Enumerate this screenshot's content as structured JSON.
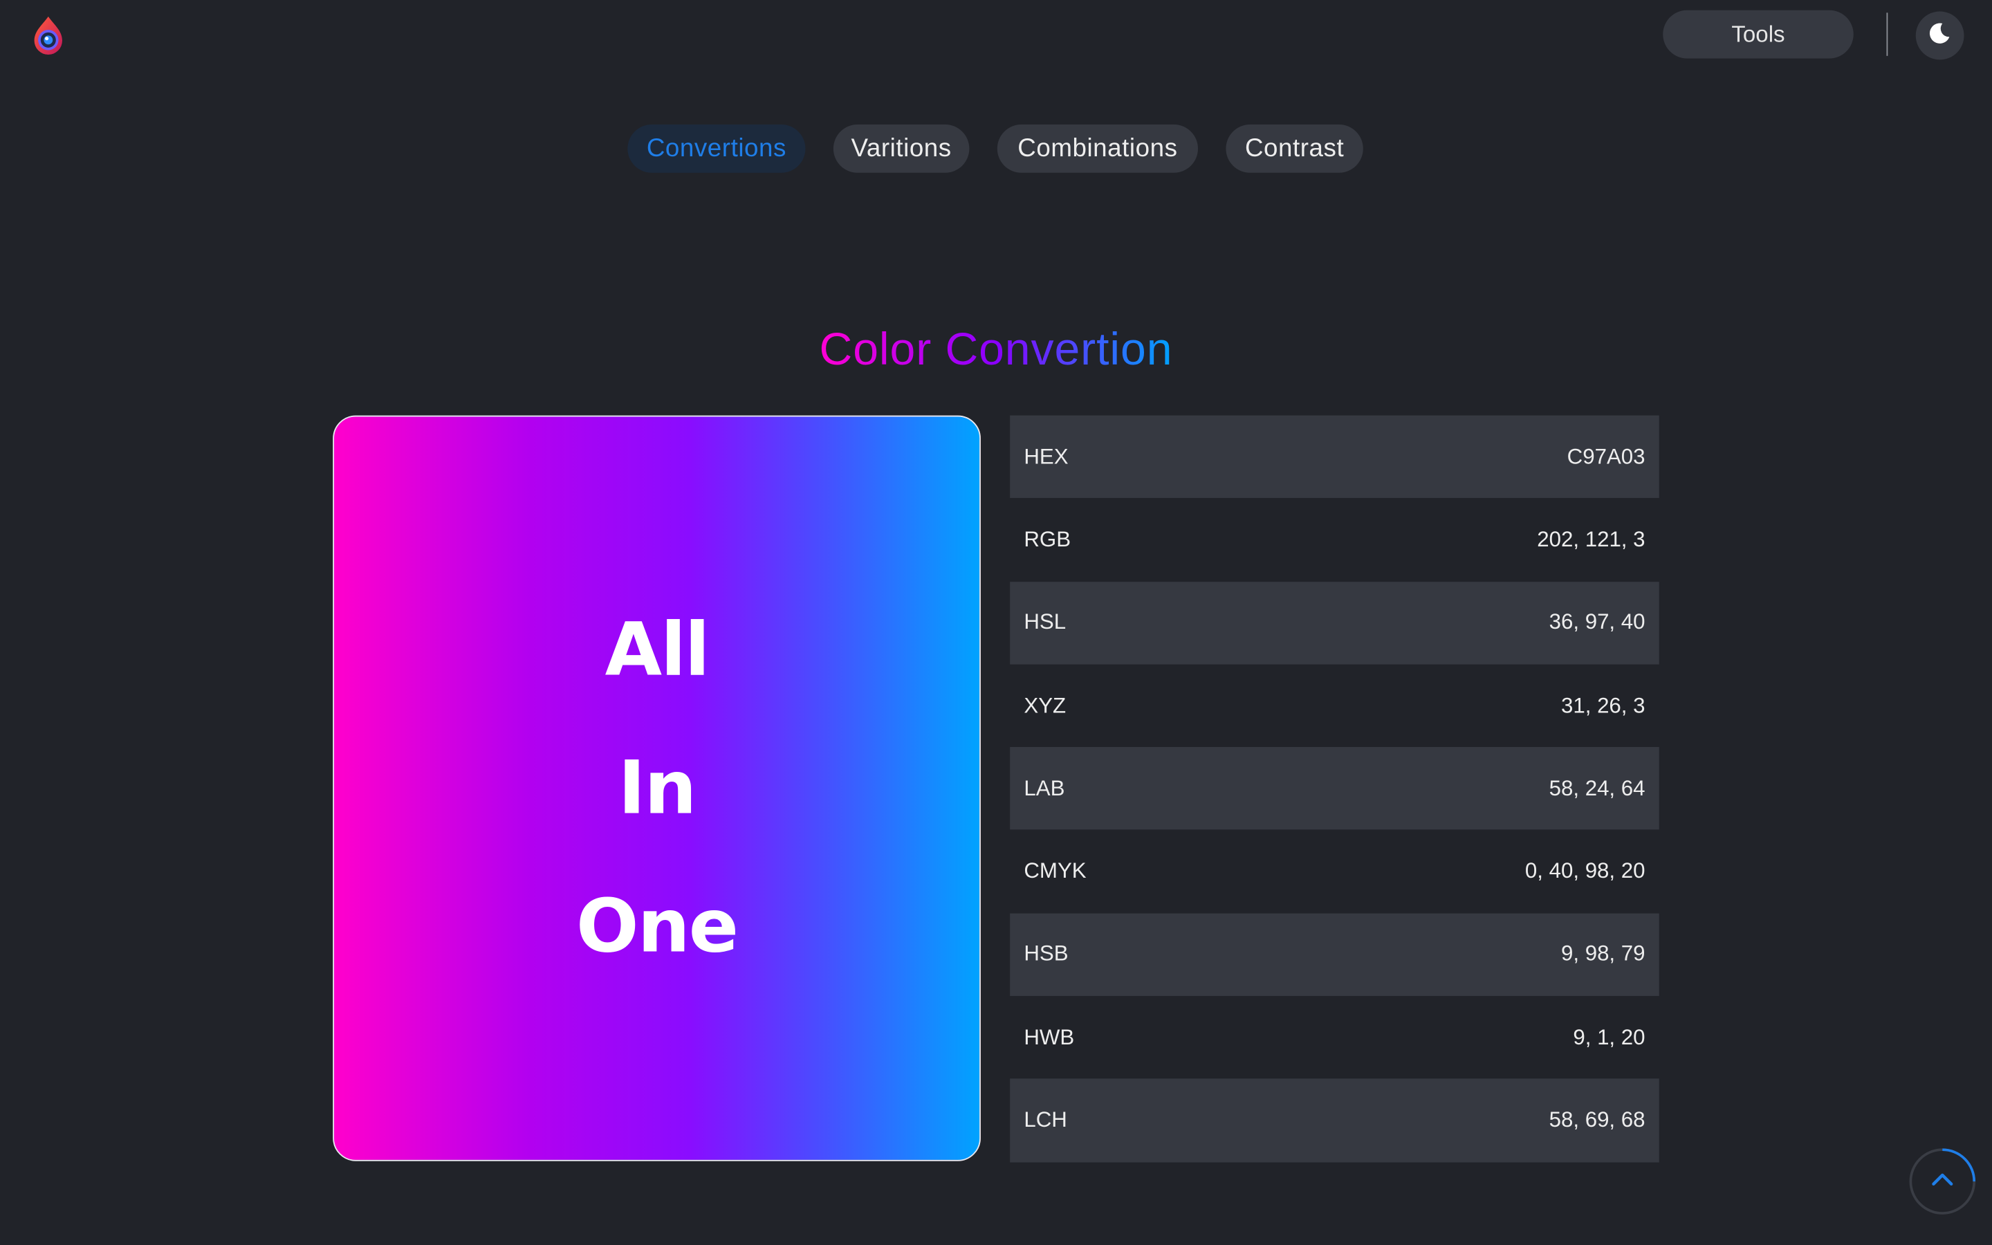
{
  "header": {
    "logo_icon": "eye-drop-logo-icon",
    "tools_label": "Tools",
    "theme_icon": "moon-icon"
  },
  "tabs": [
    {
      "label": "Convertions",
      "active": true
    },
    {
      "label": "Varitions",
      "active": false
    },
    {
      "label": "Combinations",
      "active": false
    },
    {
      "label": "Contrast",
      "active": false
    }
  ],
  "main": {
    "title": "Color Convertion",
    "hero_words": [
      "All",
      "In",
      "One"
    ],
    "conversions": [
      {
        "label": "HEX",
        "value": "C97A03"
      },
      {
        "label": "RGB",
        "value": "202, 121, 3"
      },
      {
        "label": "HSL",
        "value": "36, 97, 40"
      },
      {
        "label": "XYZ",
        "value": "31, 26, 3"
      },
      {
        "label": "LAB",
        "value": "58, 24, 64"
      },
      {
        "label": "CMYK",
        "value": "0, 40, 98, 20"
      },
      {
        "label": "HSB",
        "value": "9, 98, 79"
      },
      {
        "label": "HWB",
        "value": "9, 1, 20"
      },
      {
        "label": "LCH",
        "value": "58, 69, 68"
      }
    ]
  },
  "scroll_top_icon": "chevron-up-icon",
  "colors": {
    "background": "#212329",
    "surface": "#363941",
    "accent": "#1f7ee8",
    "gradient": [
      "#ff00cc",
      "#8a0cff",
      "#00a3ff"
    ]
  }
}
